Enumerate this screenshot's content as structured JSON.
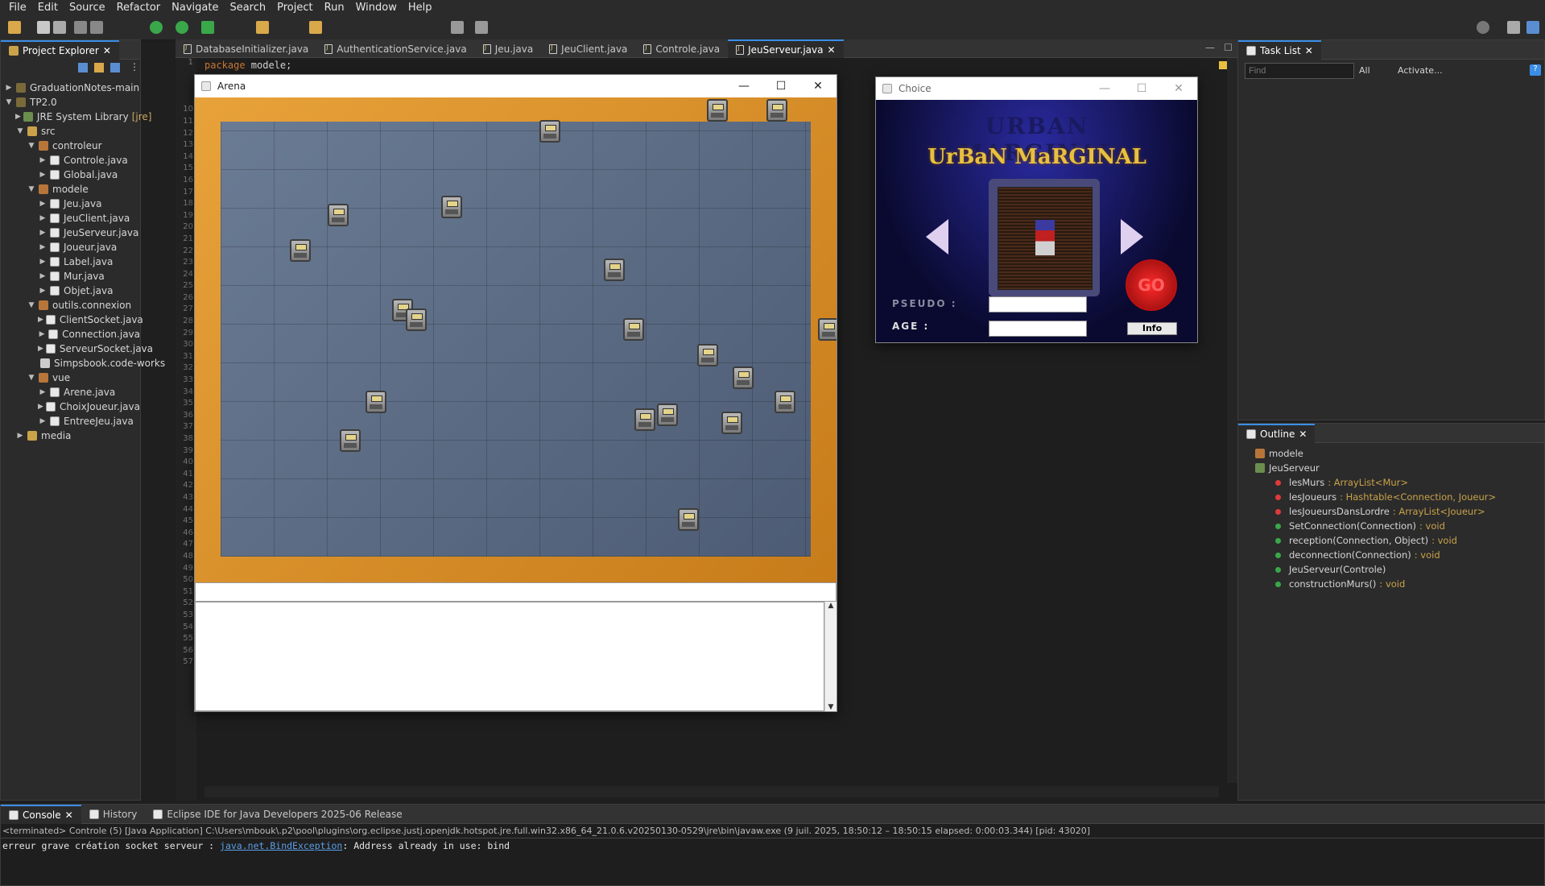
{
  "menu": [
    "File",
    "Edit",
    "Source",
    "Refactor",
    "Navigate",
    "Search",
    "Project",
    "Run",
    "Window",
    "Help"
  ],
  "project_explorer": {
    "title": "Project Explorer",
    "items": [
      {
        "label": "GraduationNotes-main",
        "level": 0,
        "icon": "project",
        "arrow": "right"
      },
      {
        "label": "TP2.0",
        "level": 0,
        "icon": "project",
        "arrow": "down"
      },
      {
        "label": "JRE System Library",
        "suffix": "[jre]",
        "level": 1,
        "icon": "library",
        "arrow": "right"
      },
      {
        "label": "src",
        "level": 1,
        "icon": "folder",
        "arrow": "down"
      },
      {
        "label": "controleur",
        "level": 2,
        "icon": "package",
        "arrow": "down"
      },
      {
        "label": "Controle.java",
        "level": 3,
        "icon": "java",
        "arrow": "right"
      },
      {
        "label": "Global.java",
        "level": 3,
        "icon": "java",
        "arrow": "right"
      },
      {
        "label": "modele",
        "level": 2,
        "icon": "package",
        "arrow": "down"
      },
      {
        "label": "Jeu.java",
        "level": 3,
        "icon": "java",
        "arrow": "right"
      },
      {
        "label": "JeuClient.java",
        "level": 3,
        "icon": "java",
        "arrow": "right"
      },
      {
        "label": "JeuServeur.java",
        "level": 3,
        "icon": "java",
        "arrow": "right"
      },
      {
        "label": "Joueur.java",
        "level": 3,
        "icon": "java",
        "arrow": "right"
      },
      {
        "label": "Label.java",
        "level": 3,
        "icon": "java",
        "arrow": "right"
      },
      {
        "label": "Mur.java",
        "level": 3,
        "icon": "java",
        "arrow": "right"
      },
      {
        "label": "Objet.java",
        "level": 3,
        "icon": "java",
        "arrow": "right"
      },
      {
        "label": "outils.connexion",
        "level": 2,
        "icon": "package",
        "arrow": "down"
      },
      {
        "label": "ClientSocket.java",
        "level": 3,
        "icon": "java",
        "arrow": "right"
      },
      {
        "label": "Connection.java",
        "level": 3,
        "icon": "java",
        "arrow": "right"
      },
      {
        "label": "ServeurSocket.java",
        "level": 3,
        "icon": "java",
        "arrow": "right"
      },
      {
        "label": "Simpsbook.code-works",
        "level": 3,
        "icon": "file",
        "arrow": ""
      },
      {
        "label": "vue",
        "level": 2,
        "icon": "package",
        "arrow": "down"
      },
      {
        "label": "Arene.java",
        "level": 3,
        "icon": "java",
        "arrow": "right"
      },
      {
        "label": "ChoixJoueur.java",
        "level": 3,
        "icon": "java",
        "arrow": "right"
      },
      {
        "label": "EntreeJeu.java",
        "level": 3,
        "icon": "java",
        "arrow": "right"
      },
      {
        "label": "media",
        "level": 1,
        "icon": "folder",
        "arrow": "right"
      }
    ]
  },
  "editor_tabs": [
    {
      "label": "DatabaseInitializer.java",
      "active": false
    },
    {
      "label": "AuthenticationService.java",
      "active": false
    },
    {
      "label": "Jeu.java",
      "active": false
    },
    {
      "label": "JeuClient.java",
      "active": false
    },
    {
      "label": "Controle.java",
      "active": false
    },
    {
      "label": "JeuServeur.java",
      "active": true
    }
  ],
  "editor": {
    "first_line_number": "1",
    "first_line_keyword": "package",
    "first_line_rest": " modele;",
    "line_numbers": [
      "1",
      "",
      "",
      "",
      "10",
      "11",
      "12",
      "13",
      "14",
      "15",
      "16",
      "17",
      "18",
      "19",
      "20",
      "21",
      "22",
      "23",
      "24",
      "25",
      "26",
      "27",
      "28",
      "29",
      "30",
      "31",
      "32",
      "33",
      "34",
      "35",
      "36",
      "37",
      "38",
      "39",
      "40",
      "41",
      "42",
      "43",
      "44",
      "45",
      "46",
      "47",
      "48",
      "49",
      "50",
      "51",
      "52",
      "53",
      "54",
      "55",
      "56",
      "57"
    ]
  },
  "arena_window": {
    "title": "Arena",
    "minimize": "—",
    "maximize": "☐",
    "close": "✕"
  },
  "choice_window": {
    "title": "Choice",
    "logo_shadow": "URBAN MARGINAL",
    "logo": "UrBaN MaRGINAL",
    "pseudo_label": "PSEUDO :",
    "age_label": "AGE :",
    "go_label": "GO",
    "info_button": "Info",
    "minimize": "—",
    "maximize": "☐",
    "close": "✕"
  },
  "task_list": {
    "title": "Task List",
    "find_placeholder": "Find",
    "all_label": "All",
    "activate_label": "Activate..."
  },
  "outline": {
    "title": "Outline",
    "items": [
      {
        "label": "modele",
        "type": "",
        "icon": "package",
        "indent": 0
      },
      {
        "label": "JeuServeur",
        "type": "",
        "icon": "class",
        "indent": 0
      },
      {
        "label": "lesMurs",
        "type": ": ArrayList<Mur>",
        "icon": "private-field",
        "indent": 1
      },
      {
        "label": "lesJoueurs",
        "type": ": Hashtable<Connection, Joueur>",
        "icon": "private-field",
        "indent": 1
      },
      {
        "label": "lesJoueursDansLordre",
        "type": ": ArrayList<Joueur>",
        "icon": "private-field",
        "indent": 1
      },
      {
        "label": "SetConnection(Connection)",
        "type": ": void",
        "icon": "public-method",
        "indent": 1
      },
      {
        "label": "reception(Connection, Object)",
        "type": ": void",
        "icon": "public-method",
        "indent": 1
      },
      {
        "label": "deconnection(Connection)",
        "type": ": void",
        "icon": "public-method",
        "indent": 1
      },
      {
        "label": "JeuServeur(Controle)",
        "type": "",
        "icon": "constructor",
        "indent": 1
      },
      {
        "label": "constructionMurs()",
        "type": ": void",
        "icon": "public-method",
        "indent": 1
      }
    ]
  },
  "console": {
    "tabs": [
      "Console",
      "History",
      "Eclipse IDE for Java Developers 2025-06 Release"
    ],
    "status_line": "<terminated> Controle (5) [Java Application] C:\\Users\\mbouk\\.p2\\pool\\plugins\\org.eclipse.justj.openjdk.hotspot.jre.full.win32.x86_64_21.0.6.v20250130-0529\\jre\\bin\\javaw.exe  (9 juil. 2025, 18:50:12 – 18:50:15 elapsed: 0:00:03.344) [pid: 43020]",
    "output_prefix": "erreur grave création socket serveur : ",
    "output_link": "java.net.BindException",
    "output_suffix": ": Address already in use: bind"
  },
  "colors": {
    "accent": "#3a8ee6",
    "arena_border": "#e8a23a",
    "floor": "#5e6f88",
    "go": "#e0202a",
    "logo": "#e8c040"
  }
}
